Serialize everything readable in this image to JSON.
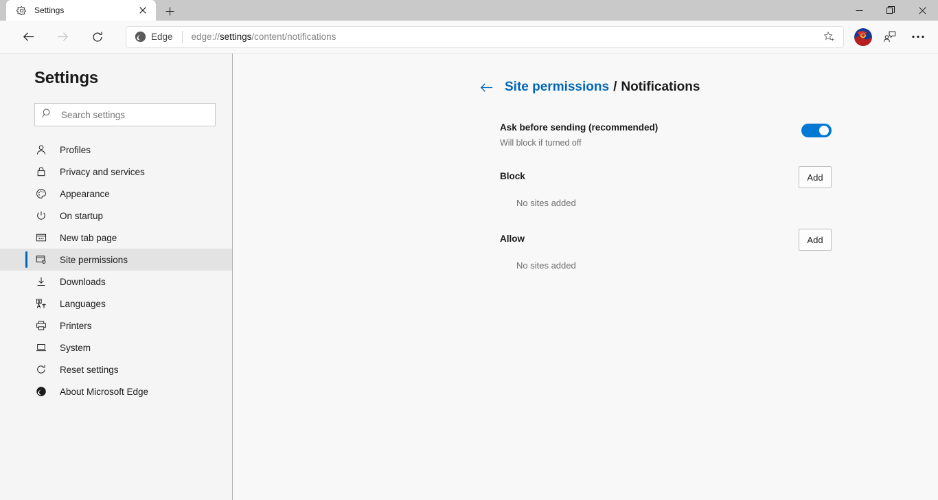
{
  "window": {
    "tab": {
      "title": "Settings",
      "favicon": "gear-icon",
      "close": "×"
    },
    "new_tab_label": "+",
    "controls": {
      "minimize": "–",
      "restore": "❐",
      "close": "✕"
    }
  },
  "toolbar": {
    "back": "back-arrow-icon",
    "forward": "forward-arrow-icon",
    "reload": "reload-icon",
    "edge_badge_label": "Edge",
    "url_prefix": "edge://",
    "url_emphasis": "settings",
    "url_suffix": "/content/notifications",
    "url_full": "edge://settings/content/notifications",
    "favorite_icon": "star-add-icon",
    "avatar_icon": "profile-avatar",
    "collections_icon": "person-feedback-icon",
    "more_icon": "more-ellipsis-icon"
  },
  "sidebar": {
    "title": "Settings",
    "search": {
      "placeholder": "Search settings",
      "icon": "search-icon"
    },
    "items": [
      {
        "label": "Profiles",
        "icon": "person-icon",
        "selected": false
      },
      {
        "label": "Privacy and services",
        "icon": "lock-icon",
        "selected": false
      },
      {
        "label": "Appearance",
        "icon": "palette-icon",
        "selected": false
      },
      {
        "label": "On startup",
        "icon": "power-icon",
        "selected": false
      },
      {
        "label": "New tab page",
        "icon": "new-tab-page-icon",
        "selected": false
      },
      {
        "label": "Site permissions",
        "icon": "site-permissions-icon",
        "selected": true
      },
      {
        "label": "Downloads",
        "icon": "download-icon",
        "selected": false
      },
      {
        "label": "Languages",
        "icon": "languages-icon",
        "selected": false
      },
      {
        "label": "Printers",
        "icon": "printer-icon",
        "selected": false
      },
      {
        "label": "System",
        "icon": "laptop-icon",
        "selected": false
      },
      {
        "label": "Reset settings",
        "icon": "reset-icon",
        "selected": false
      },
      {
        "label": "About Microsoft Edge",
        "icon": "edge-logo-icon",
        "selected": false
      }
    ]
  },
  "main": {
    "breadcrumb": {
      "back_icon": "back-arrow-icon",
      "parent": "Site permissions",
      "separator": "/",
      "current": "Notifications"
    },
    "ask_setting": {
      "title": "Ask before sending (recommended)",
      "subtitle": "Will block if turned off",
      "toggle_on": true
    },
    "sections": [
      {
        "title": "Block",
        "add_label": "Add",
        "empty_text": "No sites added"
      },
      {
        "title": "Allow",
        "add_label": "Add",
        "empty_text": "No sites added"
      }
    ]
  },
  "colors": {
    "accent": "#0078d4",
    "link": "#0067b8",
    "sidebar_bg": "#f5f5f5",
    "selected_bg": "#e3e3e3"
  }
}
